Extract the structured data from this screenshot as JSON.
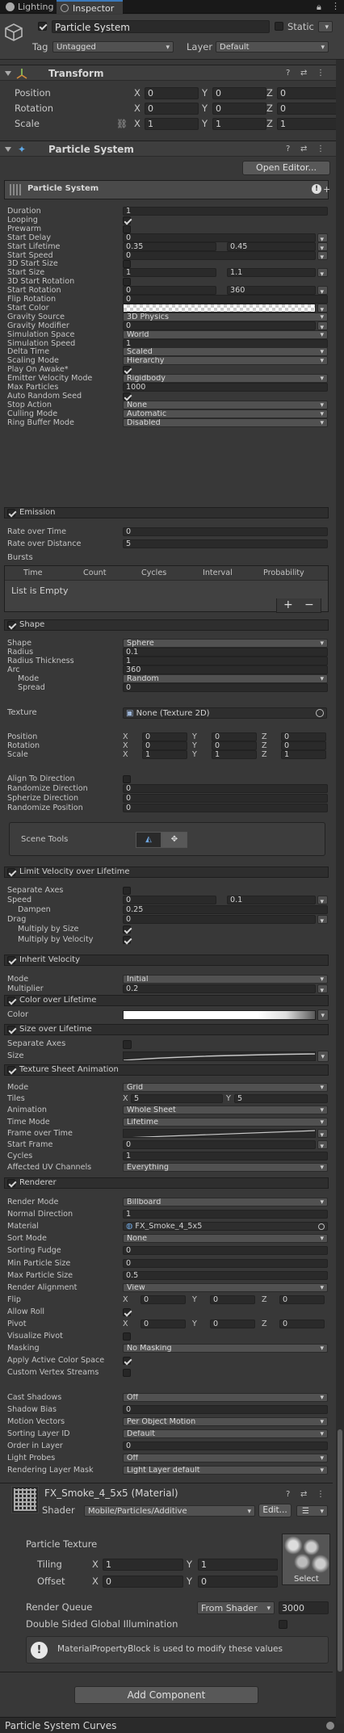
{
  "tabs": [
    {
      "label": "Lighting",
      "active": false
    },
    {
      "label": "Inspector",
      "active": true
    }
  ],
  "tab_icons": [
    "light-icon",
    "info-icon"
  ],
  "object": {
    "active": true,
    "name": "Particle System",
    "static_label": "Static",
    "tag_label": "Tag",
    "tag": "Untagged",
    "layer_label": "Layer",
    "layer": "Default"
  },
  "transform": {
    "title": "Transform",
    "rows": [
      {
        "label": "Position",
        "x": "0",
        "y": "0",
        "z": "0"
      },
      {
        "label": "Rotation",
        "x": "0",
        "y": "0",
        "z": "0"
      },
      {
        "label": "Scale",
        "x": "1",
        "y": "1",
        "z": "1"
      }
    ]
  },
  "ps": {
    "title": "Particle System",
    "open_editor": "Open Editor...",
    "panel_title": "Particle System",
    "main_rows": [
      {
        "label": "Duration",
        "value": "1"
      },
      {
        "label": "Looping",
        "check": true
      },
      {
        "label": "Prewarm",
        "check": false
      },
      {
        "label": "Start Delay",
        "value": "0",
        "dropdown": true
      },
      {
        "label": "Start Lifetime",
        "value": "0.35",
        "value2": "0.45",
        "dropdown": true
      },
      {
        "label": "Start Speed",
        "value": "0",
        "dropdown": true
      },
      {
        "label": "3D Start Size",
        "check": false
      },
      {
        "label": "Start Size",
        "value": "1",
        "value2": "1.1",
        "dropdown": true
      },
      {
        "label": "3D Start Rotation",
        "check": false
      },
      {
        "label": "Start Rotation",
        "value": "0",
        "value2": "360",
        "dropdown": true
      },
      {
        "label": "Flip Rotation",
        "value": "0"
      },
      {
        "label": "Start Color",
        "color": true
      },
      {
        "label": "Gravity Source",
        "select": "3D Physics"
      },
      {
        "label": "Gravity Modifier",
        "value": "0",
        "dropdown": true
      },
      {
        "label": "Simulation Space",
        "select": "World"
      },
      {
        "label": "Simulation Speed",
        "value": "1"
      },
      {
        "label": "Delta Time",
        "select": "Scaled"
      },
      {
        "label": "Scaling Mode",
        "select": "Hierarchy"
      },
      {
        "label": "Play On Awake*",
        "check": true
      },
      {
        "label": "Emitter Velocity Mode",
        "select": "Rigidbody"
      },
      {
        "label": "Max Particles",
        "value": "1000"
      },
      {
        "label": "Auto Random Seed",
        "check": true
      },
      {
        "label": "Stop Action",
        "select": "None"
      },
      {
        "label": "Culling Mode",
        "select": "Automatic"
      },
      {
        "label": "Ring Buffer Mode",
        "select": "Disabled"
      }
    ]
  },
  "emission": {
    "title": "Emission",
    "rows": [
      {
        "label": "Rate over Time",
        "value": "0"
      },
      {
        "label": "Rate over Distance",
        "value": "5"
      }
    ],
    "bursts_label": "Bursts",
    "columns": [
      "Time",
      "Count",
      "Cycles",
      "Interval",
      "Probability"
    ],
    "empty": "List is Empty",
    "add": "+",
    "remove": "−"
  },
  "shape": {
    "title": "Shape",
    "rows": [
      {
        "label": "Shape",
        "select": "Sphere"
      },
      {
        "label": "Radius",
        "value": "0.1"
      },
      {
        "label": "Radius Thickness",
        "value": "1"
      },
      {
        "label": "Arc",
        "value": "360"
      },
      {
        "label": "Mode",
        "select": "Random",
        "indent": true
      },
      {
        "label": "Spread",
        "value": "0",
        "indent": true
      }
    ],
    "texture_label": "Texture",
    "texture": "None (Texture 2D)",
    "vectors": [
      {
        "label": "Position",
        "x": "0",
        "y": "0",
        "z": "0"
      },
      {
        "label": "Rotation",
        "x": "0",
        "y": "0",
        "z": "0"
      },
      {
        "label": "Scale",
        "x": "1",
        "y": "1",
        "z": "1"
      }
    ],
    "rows2": [
      {
        "label": "Align To Direction",
        "check": false
      },
      {
        "label": "Randomize Direction",
        "value": "0"
      },
      {
        "label": "Spherize Direction",
        "value": "0"
      },
      {
        "label": "Randomize Position",
        "value": "0"
      }
    ],
    "scene_tools": "Scene Tools"
  },
  "limit_velocity": {
    "title": "Limit Velocity over Lifetime",
    "rows": [
      {
        "label": "Separate Axes",
        "check": false
      },
      {
        "label": "Speed",
        "value": "0",
        "value2": "0.1",
        "dropdown": true
      },
      {
        "label": "Dampen",
        "value": "0.25",
        "indent": true
      },
      {
        "label": "Drag",
        "value": "0",
        "dropdown": true
      },
      {
        "label": "Multiply by Size",
        "check": true,
        "indent": true
      },
      {
        "label": "Multiply by Velocity",
        "check": true,
        "indent": true
      }
    ]
  },
  "inherit_velocity": {
    "title": "Inherit Velocity",
    "rows": [
      {
        "label": "Mode",
        "select": "Initial"
      },
      {
        "label": "Multiplier",
        "value": "0.2",
        "dropdown": true
      }
    ]
  },
  "color_lifetime": {
    "title": "Color over Lifetime",
    "label": "Color"
  },
  "size_lifetime": {
    "title": "Size over Lifetime",
    "separate_axes": "Separate Axes",
    "size": "Size"
  },
  "texture_sheet": {
    "title": "Texture Sheet Animation",
    "rows": [
      {
        "label": "Mode",
        "select": "Grid"
      },
      {
        "label": "Tiles",
        "tiles": true
      },
      {
        "label": "Animation",
        "select": "Whole Sheet"
      },
      {
        "label": "Time Mode",
        "select": "Lifetime"
      },
      {
        "label": "Frame over Time",
        "curve": true
      },
      {
        "label": "Start Frame",
        "value": "0",
        "dropdown": true
      },
      {
        "label": "Cycles",
        "value": "1"
      },
      {
        "label": "Affected UV Channels",
        "select": "Everything"
      }
    ],
    "tiles_x": "5",
    "tiles_y": "5"
  },
  "renderer": {
    "title": "Renderer",
    "rows": [
      {
        "label": "Render Mode",
        "select": "Billboard"
      },
      {
        "label": "Normal Direction",
        "value": "1"
      },
      {
        "label": "Material",
        "object": "FX_Smoke_4_5x5"
      },
      {
        "label": "Sort Mode",
        "select": "None"
      },
      {
        "label": "Sorting Fudge",
        "value": "0"
      },
      {
        "label": "Min Particle Size",
        "value": "0"
      },
      {
        "label": "Max Particle Size",
        "value": "0.5"
      },
      {
        "label": "Render Alignment",
        "select": "View"
      },
      {
        "label": "Flip",
        "xyz": [
          "0",
          "0",
          "0"
        ]
      },
      {
        "label": "Allow Roll",
        "check": true
      },
      {
        "label": "Pivot",
        "xyz": [
          "0",
          "0",
          "0"
        ]
      },
      {
        "label": "Visualize Pivot",
        "check": false
      },
      {
        "label": "Masking",
        "select": "No Masking"
      },
      {
        "label": "Apply Active Color Space",
        "check": true
      },
      {
        "label": "Custom Vertex Streams",
        "check": false
      },
      {
        "label": "",
        "spacer": true
      },
      {
        "label": "Cast Shadows",
        "select": "Off"
      },
      {
        "label": "Shadow Bias",
        "value": "0"
      },
      {
        "label": "Motion Vectors",
        "select": "Per Object Motion"
      },
      {
        "label": "Sorting Layer ID",
        "select": "Default"
      },
      {
        "label": "Order in Layer",
        "value": "0"
      },
      {
        "label": "Light Probes",
        "select": "Off"
      },
      {
        "label": "Rendering Layer Mask",
        "select": "Light Layer default"
      }
    ]
  },
  "material": {
    "title": "FX_Smoke_4_5x5 (Material)",
    "shader_label": "Shader",
    "shader": "Mobile/Particles/Additive",
    "edit": "Edit...",
    "texture_label": "Particle Texture",
    "tiling_label": "Tiling",
    "tiling_x": "1",
    "tiling_y": "1",
    "offset_label": "Offset",
    "offset_x": "0",
    "offset_y": "0",
    "select": "Select",
    "render_queue_label": "Render Queue",
    "render_queue_mode": "From Shader",
    "render_queue": "3000",
    "double_sided": "Double Sided Global Illumination",
    "info": "MaterialPropertyBlock is used to modify these values"
  },
  "add_component": "Add Component",
  "bottom_title": "Particle System Curves"
}
